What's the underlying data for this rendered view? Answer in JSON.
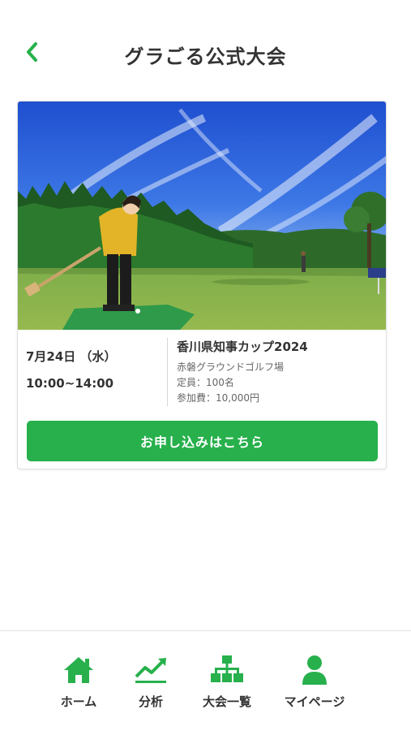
{
  "header": {
    "title": "グラごる公式大会"
  },
  "event": {
    "date": "7月24日 （水）",
    "time": "10:00~14:00",
    "name": "香川県知事カップ2024",
    "venue": "赤磐グラウンドゴルフ場",
    "capacity": "定員：100名",
    "fee": "参加費：10,000円",
    "apply_label": "お申し込みはこちら"
  },
  "nav": {
    "items": [
      {
        "label": "ホーム",
        "icon": "home-icon"
      },
      {
        "label": "分析",
        "icon": "chart-trend-icon"
      },
      {
        "label": "大会一覧",
        "icon": "tournament-icon"
      },
      {
        "label": "マイページ",
        "icon": "user-icon"
      }
    ]
  },
  "colors": {
    "accent": "#27b04c",
    "text": "#333333"
  }
}
